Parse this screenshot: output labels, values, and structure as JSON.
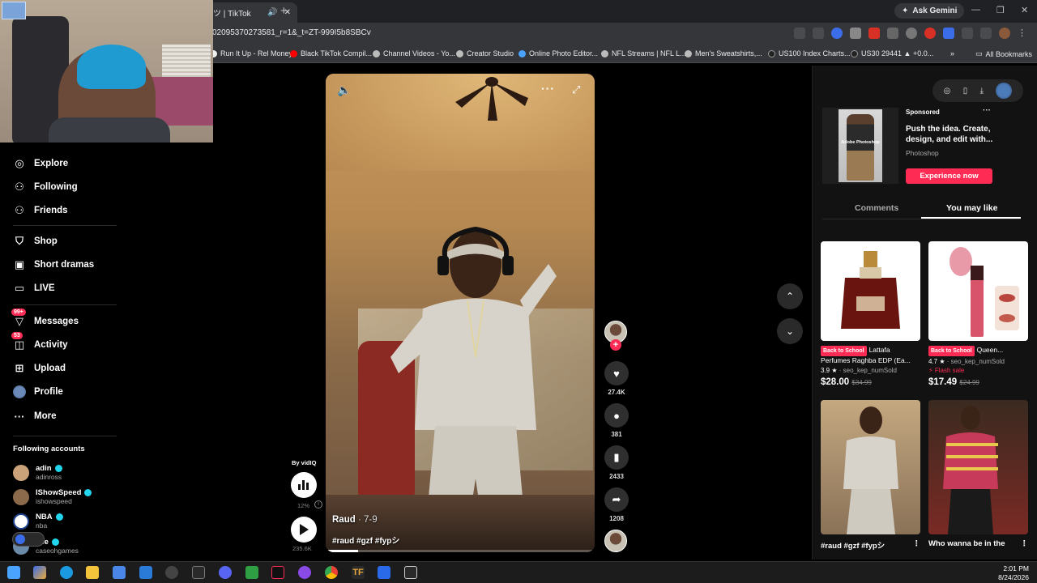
{
  "browser": {
    "tab_title": "ツ | TikTok",
    "url": "02095370273581_r=1&_t=ZT-999I5b8SBCv",
    "ask_gemini": "Ask Gemini",
    "new_tab": "+",
    "bookmarks": [
      {
        "label": "Run It Up - Rel Money",
        "color": "#f0f0f0"
      },
      {
        "label": "Black TikTok Compil...",
        "color": "#ff0000"
      },
      {
        "label": "Channel Videos - Yo...",
        "color": "#bbbbbb"
      },
      {
        "label": "Creator Studio",
        "color": "#bbbbbb"
      },
      {
        "label": "Online Photo Editor...",
        "color": "#4aa3ff"
      },
      {
        "label": "NFL Streams | NFL L...",
        "color": "#bbbbbb"
      },
      {
        "label": "Men's Sweatshirts,...",
        "color": "#bbbbbb"
      },
      {
        "label": "US100 Index Charts...",
        "color": "#222222"
      },
      {
        "label": "US30 29441 ▲ +0.0...",
        "color": "#222222"
      }
    ],
    "all_bookmarks": "All Bookmarks"
  },
  "nav": {
    "items": [
      {
        "label": "Explore",
        "icon": "compass-icon",
        "glyph": "◎"
      },
      {
        "label": "Following",
        "icon": "following-icon",
        "glyph": "⚇"
      },
      {
        "label": "Friends",
        "icon": "friends-icon",
        "glyph": "⚇"
      },
      {
        "label": "Shop",
        "icon": "shop-icon",
        "glyph": "⛉"
      },
      {
        "label": "Short dramas",
        "icon": "dramas-icon",
        "glyph": "▣"
      },
      {
        "label": "LIVE",
        "icon": "live-icon",
        "glyph": "▭"
      },
      {
        "label": "Messages",
        "icon": "messages-icon",
        "glyph": "▽",
        "badge": "99+"
      },
      {
        "label": "Activity",
        "icon": "activity-icon",
        "glyph": "◫",
        "badge": "53"
      },
      {
        "label": "Upload",
        "icon": "upload-icon",
        "glyph": "⊞"
      },
      {
        "label": "Profile",
        "icon": "profile-icon",
        "glyph": "●"
      },
      {
        "label": "More",
        "icon": "more-icon",
        "glyph": "···"
      }
    ],
    "following_title": "Following accounts",
    "accounts": [
      {
        "name": "adin",
        "handle": "adinross",
        "color": "#c9a27a"
      },
      {
        "name": "IShowSpeed",
        "handle": "ishowspeed",
        "color": "#8a6a4a"
      },
      {
        "name": "NBA",
        "handle": "nba",
        "color": "#ffffff"
      },
      {
        "name": "ase",
        "handle": "caseohgames",
        "color": "#6a8aa8"
      }
    ]
  },
  "video": {
    "author": "Raud",
    "date": "· 7-9",
    "tags": "#raud #gzf #fypシ",
    "progress": 0.12,
    "likes": "27.4K",
    "comments": "381",
    "saves": "2433",
    "shares": "1208"
  },
  "vidiq": {
    "by": "By vidIQ",
    "pct": "12%",
    "views": "235.6K"
  },
  "panel": {
    "ad": {
      "sponsored": "Sponsored",
      "text": "Push the idea. Create, design, and edit with...",
      "brand": "Photoshop",
      "cta": "Experience now",
      "img_caption": "Adobe Photoshop"
    },
    "tabs": [
      "Comments",
      "You may like"
    ],
    "products": [
      {
        "tag": "Back to School",
        "title": "Lattafa Perfumes Raghba EDP (Ea...",
        "rating": "3.9 ★",
        "sold": "· seo_kep_numSold",
        "flash": "",
        "price": "$28.00",
        "old_price": "$34.99"
      },
      {
        "tag": "Back to School",
        "title": "Queen...",
        "rating": "4.7 ★",
        "sold": "· seo_kep_numSold",
        "flash": "⚡ Flash sale",
        "price": "$17.49",
        "old_price": "$24.99"
      }
    ],
    "videos": [
      {
        "title": "#raud #gzf #fypシ"
      },
      {
        "title": "Who wanna be in the"
      }
    ]
  },
  "taskbar": {
    "time": "2:01 PM",
    "date": "8/24/2026"
  }
}
